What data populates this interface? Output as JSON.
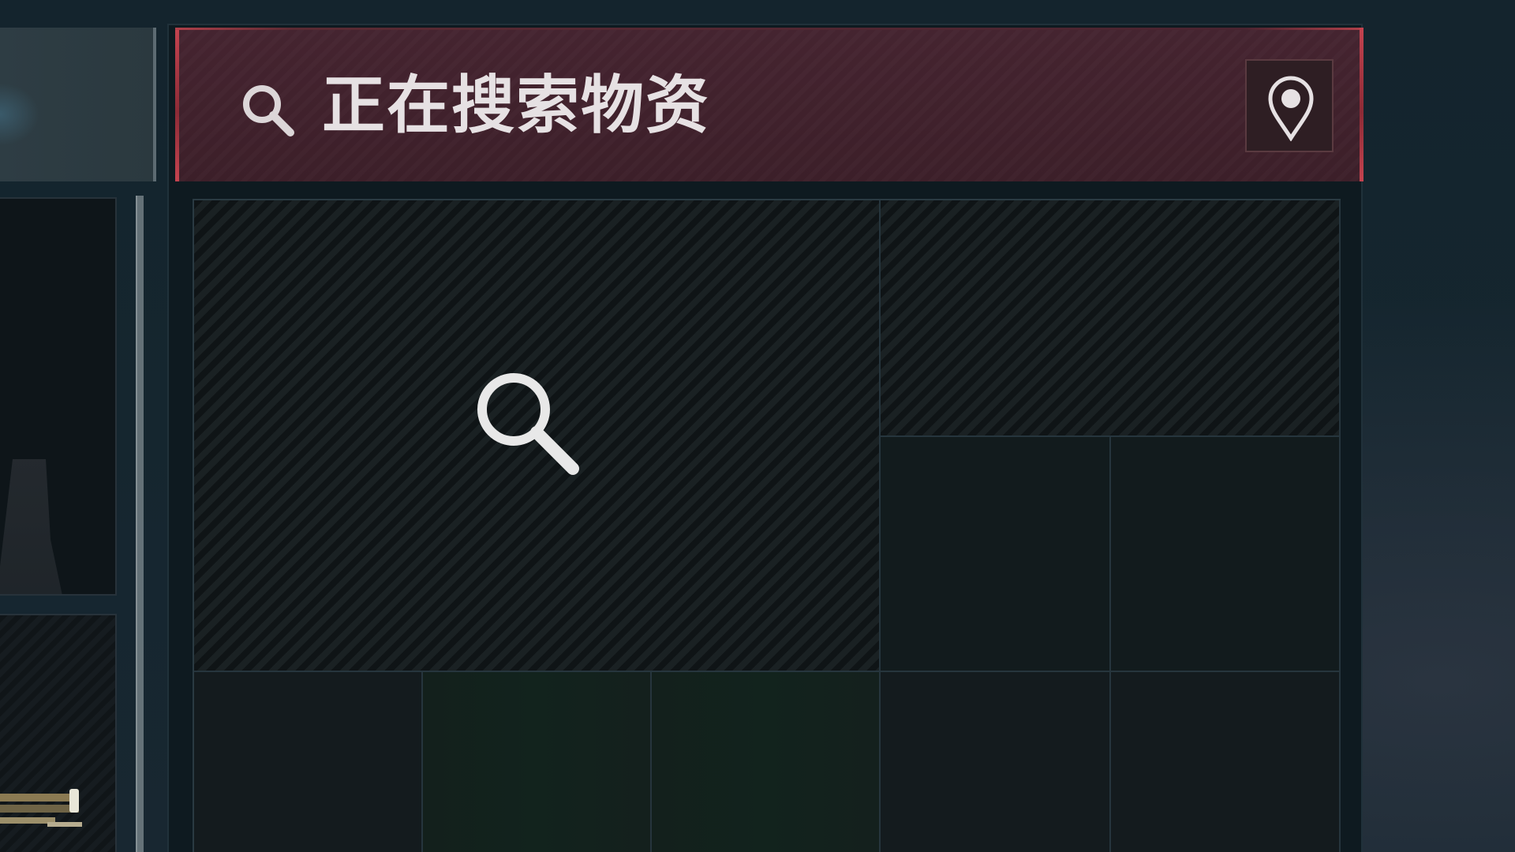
{
  "header": {
    "title": "正在搜索物资",
    "search_icon": "search-icon",
    "locate_icon": "map-pin-icon"
  },
  "loot_grid": {
    "searching_icon": "search-icon",
    "colors": {
      "header_background": "#3f2029",
      "header_accent": "#c4434f",
      "background": "#13232c"
    }
  }
}
